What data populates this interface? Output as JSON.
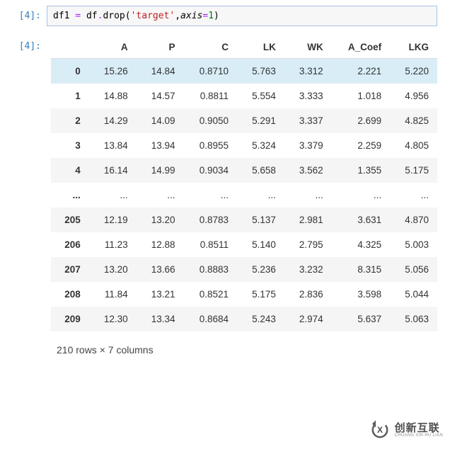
{
  "prompts": {
    "in": "[4]:",
    "out": "[4]:"
  },
  "code": {
    "var": "df1",
    "eq": " = ",
    "obj": "df",
    "dot": ".",
    "method": "drop",
    "open": "(",
    "str": "'target'",
    "comma": ",",
    "arg": "axis",
    "eq2": "=",
    "num": "1",
    "close": ")"
  },
  "chart_data": {
    "type": "table",
    "columns": [
      "A",
      "P",
      "C",
      "LK",
      "WK",
      "A_Coef",
      "LKG"
    ],
    "index": [
      "0",
      "1",
      "2",
      "3",
      "4",
      "...",
      "205",
      "206",
      "207",
      "208",
      "209"
    ],
    "rows": [
      [
        "15.26",
        "14.84",
        "0.8710",
        "5.763",
        "3.312",
        "2.221",
        "5.220"
      ],
      [
        "14.88",
        "14.57",
        "0.8811",
        "5.554",
        "3.333",
        "1.018",
        "4.956"
      ],
      [
        "14.29",
        "14.09",
        "0.9050",
        "5.291",
        "3.337",
        "2.699",
        "4.825"
      ],
      [
        "13.84",
        "13.94",
        "0.8955",
        "5.324",
        "3.379",
        "2.259",
        "4.805"
      ],
      [
        "16.14",
        "14.99",
        "0.9034",
        "5.658",
        "3.562",
        "1.355",
        "5.175"
      ],
      [
        "...",
        "...",
        "...",
        "...",
        "...",
        "...",
        "..."
      ],
      [
        "12.19",
        "13.20",
        "0.8783",
        "5.137",
        "2.981",
        "3.631",
        "4.870"
      ],
      [
        "11.23",
        "12.88",
        "0.8511",
        "5.140",
        "2.795",
        "4.325",
        "5.003"
      ],
      [
        "13.20",
        "13.66",
        "0.8883",
        "5.236",
        "3.232",
        "8.315",
        "5.056"
      ],
      [
        "11.84",
        "13.21",
        "0.8521",
        "5.175",
        "2.836",
        "3.598",
        "5.044"
      ],
      [
        "12.30",
        "13.34",
        "0.8684",
        "5.243",
        "2.974",
        "5.637",
        "5.063"
      ]
    ],
    "summary": "210 rows × 7 columns"
  },
  "logo": {
    "zh": "创新互联",
    "en": "CHUANG XIN HU LIAN"
  }
}
